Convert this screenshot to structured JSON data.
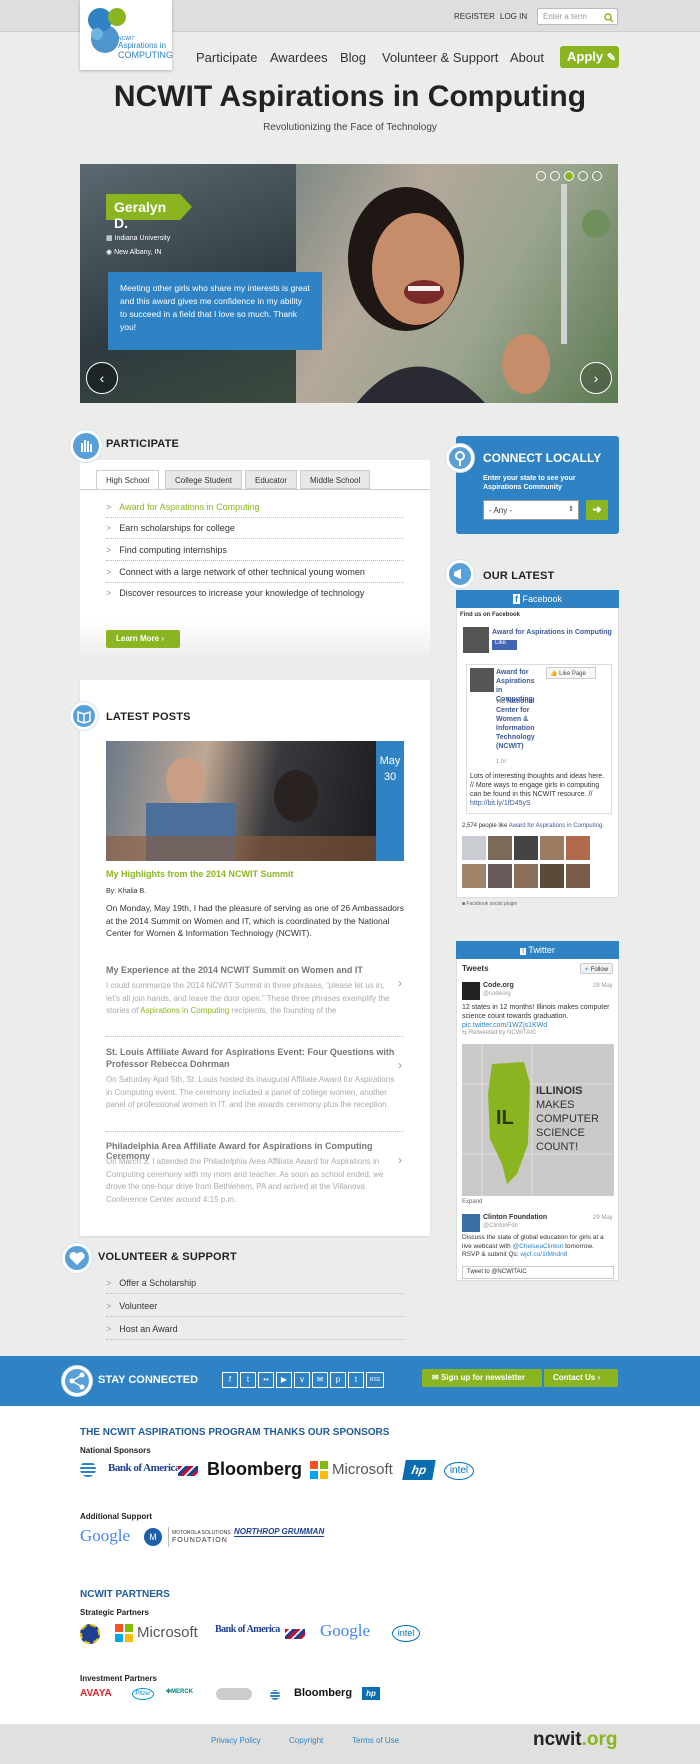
{
  "header": {
    "register": "REGISTER",
    "login": "LOG IN",
    "search_placeholder": "Enter a term",
    "logo_small": "NCWIT",
    "logo_line1": "Aspirations in",
    "logo_line2": "COMPUTING"
  },
  "nav": {
    "items": [
      "Participate",
      "Awardees",
      "Blog",
      "Volunteer & Support",
      "About"
    ],
    "apply": "Apply"
  },
  "page": {
    "title": "NCWIT Aspirations in Computing",
    "subtitle": "Revolutionizing the Face of Technology"
  },
  "hero": {
    "name": "Geralyn D.",
    "school": "Indiana University",
    "location": "New Albany, IN",
    "quote": "Meeting other girls who share my interests is great and this award gives me confidence in my ability to succeed in a field that I love so much. Thank you!"
  },
  "participate": {
    "heading": "PARTICIPATE",
    "tabs": [
      "High School",
      "College Student",
      "Educator",
      "Middle School"
    ],
    "items": [
      "Award for Aspirations in Computing",
      "Earn scholarships for college",
      "Find computing internships",
      "Connect with a large network of other technical young women",
      "Discover resources to increase your knowledge of technology"
    ],
    "learn_more": "Learn More"
  },
  "connect": {
    "heading": "CONNECT LOCALLY",
    "prompt": "Enter your state to see your Aspirations Community",
    "select_value": "- Any -"
  },
  "latest": {
    "heading": "OUR LATEST",
    "facebook": {
      "title": "Facebook",
      "find_us": "Find us on Facebook",
      "page_name": "Award for Aspirations in Computing",
      "like": "Like",
      "like_page": "Like Page",
      "post_title": "Award for Aspirations in Computing",
      "via": "via",
      "via_name": "National Center for Women & Information Technology (NCWIT)",
      "time": "1 hr",
      "post_text": "Lots of interesting thoughts and ideas here. // More ways to engage girls in computing can be found in this NCWIT resource. //",
      "post_link": "http://bit.ly/1fD45yS",
      "people_prefix": "2,574 people like",
      "people_link": "Award for Aspirations in Computing.",
      "plugin": "Facebook social plugin"
    },
    "twitter": {
      "title": "Twitter",
      "tweets": "Tweets",
      "follow": "Follow",
      "t1_name": "Code.org",
      "t1_handle": "@codeorg",
      "t1_date": "28 May",
      "t1_text": "12 states in 12 months! Illinois makes computer science count towards graduation.",
      "t1_link": "pic.twitter.com/1WZjs1KWd",
      "t1_rt": "Retweeted by NCWITAIC",
      "map_code": "IL",
      "map_l1": "ILLINOIS",
      "map_l2": "MAKES",
      "map_l3": "COMPUTER",
      "map_l4": "SCIENCE",
      "map_l5": "COUNT!",
      "expand": "Expand",
      "t2_name": "Clinton Foundation",
      "t2_handle": "@ClintonFdn",
      "t2_date": "29 May",
      "t2_text_a": "Discuss the state of global education for girls at a live webcast with",
      "t2_mention": "@ChelseaClinton",
      "t2_text_b": "tomorrow. RSVP & submit Qs:",
      "t2_link": "wjcf.co/1tMndn8",
      "tweet_to": "Tweet to @NCWITAIC"
    }
  },
  "posts": {
    "heading": "LATEST POSTS",
    "date_month": "May",
    "date_day": "30",
    "featured_title": "My Highlights from the 2014 NCWIT Summit",
    "featured_by": "By: Khalia B.",
    "featured_text": "On Monday, May 19th, I had the pleasure of serving as one of 26 Ambassadors at the 2014 Summit on Women and IT, which is coordinated by the National Center for Women & Information Technology (NCWIT).",
    "p1_title": "My Experience at the 2014 NCWIT Summit on Women and IT",
    "p1_text_a": "I could summarize the 2014 NCWIT Summit in three phrases, \"please let us in, let's all join hands, and leave the door open.\" These three phrases exemplify the stories of",
    "p1_link": "Aspirations in Computing",
    "p1_text_b": "recipients, the founding of the",
    "p2_title": "St. Louis Affiliate Award for Aspirations Event: Four Questions with Professor Rebecca Dohrman",
    "p2_text": "On Saturday April 5th, St. Louis hosted its inaugural Affiliate Award for Aspirations in Computing event. The ceremony included a panel of college women, another panel of professional women in IT, and the awards ceremony plus the reception.",
    "p3_title": "Philadelphia Area Affiliate Award for Aspirations in Computing Ceremony",
    "p3_text": "On March 3, I attended the Philadelphia Area Affiliate Award for Aspirations in Computing ceremony with my mom and teacher. As soon as school ended, we drove the one-hour drive from Bethlehem, PA and arrived at the Villanova Conference Center around 4:15 p.m."
  },
  "volunteer": {
    "heading": "VOLUNTEER & SUPPORT",
    "items": [
      "Offer a Scholarship",
      "Volunteer",
      "Host an Award"
    ]
  },
  "stay": {
    "heading": "STAY CONNECTED",
    "rss": "RSS",
    "newsletter": "Sign up for newsletter",
    "contact": "Contact Us"
  },
  "sponsors": {
    "heading": "THE NCWIT ASPIRATIONS PROGRAM THANKS OUR SPONSORS",
    "national": "National Sponsors",
    "additional": "Additional Support",
    "boa": "Bank of America",
    "bloomberg": "Bloomberg",
    "microsoft": "Microsoft",
    "hp": "hp",
    "intel": "intel",
    "google": "Google",
    "moto1": "MOTOROLA SOLUTIONS",
    "moto2": "FOUNDATION",
    "northrop": "NORTHROP GRUMMAN"
  },
  "partners": {
    "heading": "NCWIT PARTNERS",
    "strategic": "Strategic Partners",
    "investment": "Investment Partners",
    "avaya": "AVAYA",
    "pfizer": "Pfizer",
    "merck": "MERCK",
    "bloomberg": "Bloomberg",
    "hp": "hp"
  },
  "footer": {
    "privacy": "Privacy Policy",
    "copyright": "Copyright",
    "terms": "Terms of Use",
    "brand_a": "ncwit",
    "brand_b": ".org"
  },
  "colors": {
    "green": "#8bb520",
    "blue": "#2f83c4",
    "darkblue": "#1f5a99"
  }
}
